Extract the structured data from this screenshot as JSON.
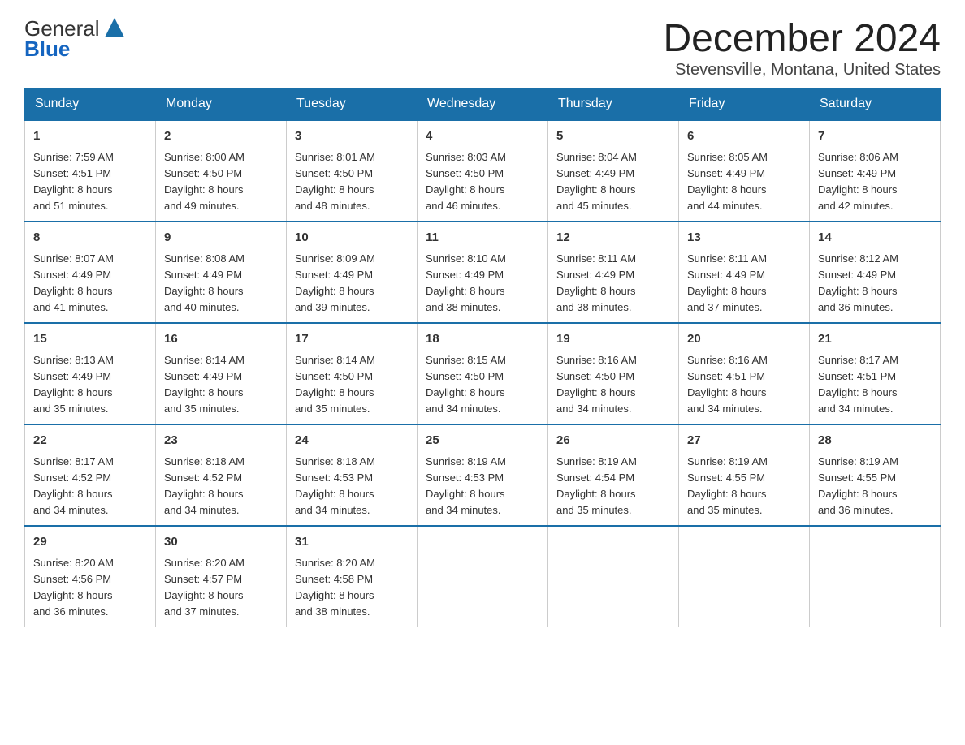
{
  "header": {
    "logo_text_general": "General",
    "logo_text_blue": "Blue",
    "month_title": "December 2024",
    "location": "Stevensville, Montana, United States"
  },
  "weekdays": [
    "Sunday",
    "Monday",
    "Tuesday",
    "Wednesday",
    "Thursday",
    "Friday",
    "Saturday"
  ],
  "weeks": [
    [
      {
        "day": "1",
        "sunrise": "Sunrise: 7:59 AM",
        "sunset": "Sunset: 4:51 PM",
        "daylight": "Daylight: 8 hours",
        "daylight2": "and 51 minutes."
      },
      {
        "day": "2",
        "sunrise": "Sunrise: 8:00 AM",
        "sunset": "Sunset: 4:50 PM",
        "daylight": "Daylight: 8 hours",
        "daylight2": "and 49 minutes."
      },
      {
        "day": "3",
        "sunrise": "Sunrise: 8:01 AM",
        "sunset": "Sunset: 4:50 PM",
        "daylight": "Daylight: 8 hours",
        "daylight2": "and 48 minutes."
      },
      {
        "day": "4",
        "sunrise": "Sunrise: 8:03 AM",
        "sunset": "Sunset: 4:50 PM",
        "daylight": "Daylight: 8 hours",
        "daylight2": "and 46 minutes."
      },
      {
        "day": "5",
        "sunrise": "Sunrise: 8:04 AM",
        "sunset": "Sunset: 4:49 PM",
        "daylight": "Daylight: 8 hours",
        "daylight2": "and 45 minutes."
      },
      {
        "day": "6",
        "sunrise": "Sunrise: 8:05 AM",
        "sunset": "Sunset: 4:49 PM",
        "daylight": "Daylight: 8 hours",
        "daylight2": "and 44 minutes."
      },
      {
        "day": "7",
        "sunrise": "Sunrise: 8:06 AM",
        "sunset": "Sunset: 4:49 PM",
        "daylight": "Daylight: 8 hours",
        "daylight2": "and 42 minutes."
      }
    ],
    [
      {
        "day": "8",
        "sunrise": "Sunrise: 8:07 AM",
        "sunset": "Sunset: 4:49 PM",
        "daylight": "Daylight: 8 hours",
        "daylight2": "and 41 minutes."
      },
      {
        "day": "9",
        "sunrise": "Sunrise: 8:08 AM",
        "sunset": "Sunset: 4:49 PM",
        "daylight": "Daylight: 8 hours",
        "daylight2": "and 40 minutes."
      },
      {
        "day": "10",
        "sunrise": "Sunrise: 8:09 AM",
        "sunset": "Sunset: 4:49 PM",
        "daylight": "Daylight: 8 hours",
        "daylight2": "and 39 minutes."
      },
      {
        "day": "11",
        "sunrise": "Sunrise: 8:10 AM",
        "sunset": "Sunset: 4:49 PM",
        "daylight": "Daylight: 8 hours",
        "daylight2": "and 38 minutes."
      },
      {
        "day": "12",
        "sunrise": "Sunrise: 8:11 AM",
        "sunset": "Sunset: 4:49 PM",
        "daylight": "Daylight: 8 hours",
        "daylight2": "and 38 minutes."
      },
      {
        "day": "13",
        "sunrise": "Sunrise: 8:11 AM",
        "sunset": "Sunset: 4:49 PM",
        "daylight": "Daylight: 8 hours",
        "daylight2": "and 37 minutes."
      },
      {
        "day": "14",
        "sunrise": "Sunrise: 8:12 AM",
        "sunset": "Sunset: 4:49 PM",
        "daylight": "Daylight: 8 hours",
        "daylight2": "and 36 minutes."
      }
    ],
    [
      {
        "day": "15",
        "sunrise": "Sunrise: 8:13 AM",
        "sunset": "Sunset: 4:49 PM",
        "daylight": "Daylight: 8 hours",
        "daylight2": "and 35 minutes."
      },
      {
        "day": "16",
        "sunrise": "Sunrise: 8:14 AM",
        "sunset": "Sunset: 4:49 PM",
        "daylight": "Daylight: 8 hours",
        "daylight2": "and 35 minutes."
      },
      {
        "day": "17",
        "sunrise": "Sunrise: 8:14 AM",
        "sunset": "Sunset: 4:50 PM",
        "daylight": "Daylight: 8 hours",
        "daylight2": "and 35 minutes."
      },
      {
        "day": "18",
        "sunrise": "Sunrise: 8:15 AM",
        "sunset": "Sunset: 4:50 PM",
        "daylight": "Daylight: 8 hours",
        "daylight2": "and 34 minutes."
      },
      {
        "day": "19",
        "sunrise": "Sunrise: 8:16 AM",
        "sunset": "Sunset: 4:50 PM",
        "daylight": "Daylight: 8 hours",
        "daylight2": "and 34 minutes."
      },
      {
        "day": "20",
        "sunrise": "Sunrise: 8:16 AM",
        "sunset": "Sunset: 4:51 PM",
        "daylight": "Daylight: 8 hours",
        "daylight2": "and 34 minutes."
      },
      {
        "day": "21",
        "sunrise": "Sunrise: 8:17 AM",
        "sunset": "Sunset: 4:51 PM",
        "daylight": "Daylight: 8 hours",
        "daylight2": "and 34 minutes."
      }
    ],
    [
      {
        "day": "22",
        "sunrise": "Sunrise: 8:17 AM",
        "sunset": "Sunset: 4:52 PM",
        "daylight": "Daylight: 8 hours",
        "daylight2": "and 34 minutes."
      },
      {
        "day": "23",
        "sunrise": "Sunrise: 8:18 AM",
        "sunset": "Sunset: 4:52 PM",
        "daylight": "Daylight: 8 hours",
        "daylight2": "and 34 minutes."
      },
      {
        "day": "24",
        "sunrise": "Sunrise: 8:18 AM",
        "sunset": "Sunset: 4:53 PM",
        "daylight": "Daylight: 8 hours",
        "daylight2": "and 34 minutes."
      },
      {
        "day": "25",
        "sunrise": "Sunrise: 8:19 AM",
        "sunset": "Sunset: 4:53 PM",
        "daylight": "Daylight: 8 hours",
        "daylight2": "and 34 minutes."
      },
      {
        "day": "26",
        "sunrise": "Sunrise: 8:19 AM",
        "sunset": "Sunset: 4:54 PM",
        "daylight": "Daylight: 8 hours",
        "daylight2": "and 35 minutes."
      },
      {
        "day": "27",
        "sunrise": "Sunrise: 8:19 AM",
        "sunset": "Sunset: 4:55 PM",
        "daylight": "Daylight: 8 hours",
        "daylight2": "and 35 minutes."
      },
      {
        "day": "28",
        "sunrise": "Sunrise: 8:19 AM",
        "sunset": "Sunset: 4:55 PM",
        "daylight": "Daylight: 8 hours",
        "daylight2": "and 36 minutes."
      }
    ],
    [
      {
        "day": "29",
        "sunrise": "Sunrise: 8:20 AM",
        "sunset": "Sunset: 4:56 PM",
        "daylight": "Daylight: 8 hours",
        "daylight2": "and 36 minutes."
      },
      {
        "day": "30",
        "sunrise": "Sunrise: 8:20 AM",
        "sunset": "Sunset: 4:57 PM",
        "daylight": "Daylight: 8 hours",
        "daylight2": "and 37 minutes."
      },
      {
        "day": "31",
        "sunrise": "Sunrise: 8:20 AM",
        "sunset": "Sunset: 4:58 PM",
        "daylight": "Daylight: 8 hours",
        "daylight2": "and 38 minutes."
      },
      null,
      null,
      null,
      null
    ]
  ]
}
